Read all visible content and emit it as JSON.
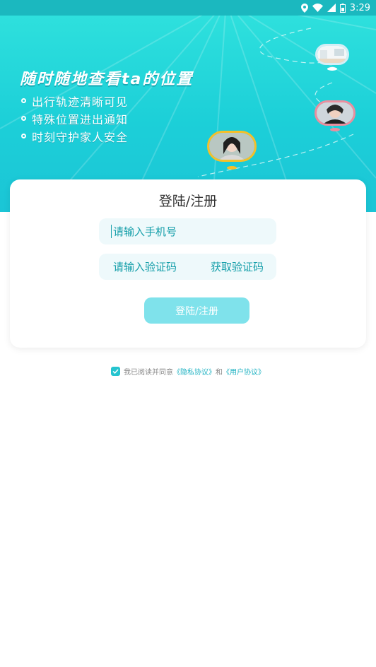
{
  "status_bar": {
    "time": "3:29",
    "icons": [
      "location-icon",
      "wifi-icon",
      "signal-icon",
      "battery-icon"
    ]
  },
  "hero": {
    "title": "随时随地查看ta的位置",
    "features": [
      "出行轨迹清晰可见",
      "特殊位置进出通知",
      "时刻守护家人安全"
    ]
  },
  "card": {
    "title": "登陆/注册",
    "phone_placeholder": "请输入手机号",
    "code_placeholder": "请输入验证码",
    "get_code_label": "获取验证码",
    "login_label": "登陆/注册"
  },
  "agreement": {
    "prefix": "我已阅读并同意",
    "privacy_link": "《隐私协议》",
    "and": "和",
    "user_link": "《用户协议》",
    "checked": true
  },
  "colors": {
    "accent": "#25c4cf",
    "hero_top": "#2ee0dd",
    "button": "#7fe2eb"
  }
}
